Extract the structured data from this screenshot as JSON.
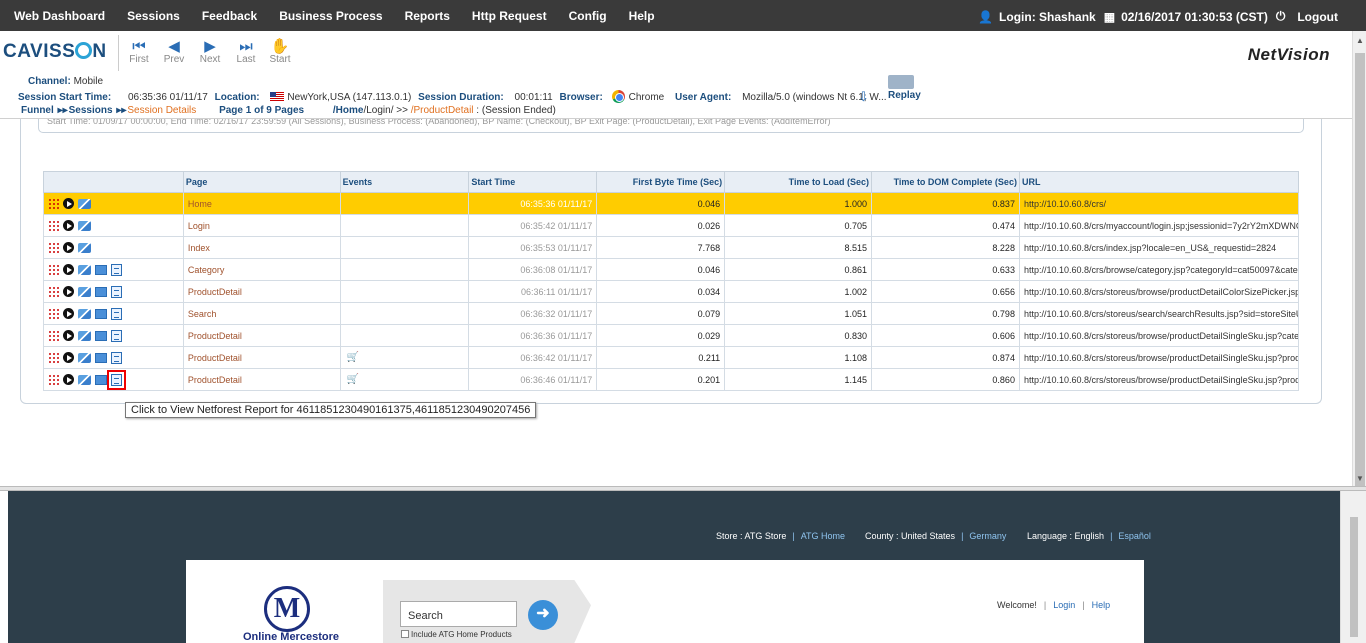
{
  "topnav": {
    "menu": [
      "Web Dashboard",
      "Sessions",
      "Feedback",
      "Business Process",
      "Reports",
      "Http Request",
      "Config",
      "Help"
    ],
    "login": "Login: Shashank",
    "datetime": "02/16/2017 01:30:53 (CST)",
    "logout": "Logout"
  },
  "header": {
    "logo": "CAVISS",
    "logo_tail": "N",
    "product": "NetVision",
    "nav": [
      {
        "label": "First",
        "glyph": "⏮"
      },
      {
        "label": "Prev",
        "glyph": "◀"
      },
      {
        "label": "Next",
        "glyph": "▶"
      },
      {
        "label": "Last",
        "glyph": "⏭"
      },
      {
        "label": "Start",
        "glyph": "✋"
      }
    ]
  },
  "session": {
    "channel_label": "Channel:",
    "channel": "Mobile",
    "start_label": "Session Start Time:",
    "start": "06:35:36 01/11/17",
    "location_label": "Location:",
    "location": "NewYork,USA (147.113.0.1)",
    "duration_label": "Session Duration:",
    "duration": "00:01:11",
    "browser_label": "Browser:",
    "browser": "Chrome",
    "agent_label": "User Agent:",
    "agent": "Mozilla/5.0 (windows Nt 6.1; W...",
    "replay": "Replay"
  },
  "breadcrumb": {
    "funnel": "Funnel",
    "sessions": "Sessions",
    "details": "Session Details",
    "page_of": "Page 1 of 9 Pages",
    "path_home": "/Home",
    "path_mid": "/Login/ >> ",
    "path_last": "/ProductDetail",
    "path_tail": " : (Session Ended)"
  },
  "filter_text": "Start Time: 01/09/17 00:00:00, End Time: 02/16/17 23:59:59 (All Sessions), Business Process: (Abandoned), BP Name: (Checkout), BP Exit Page: (ProductDetail), Exit Page Events: (AddItemError)",
  "table": {
    "headers": [
      "",
      "Page",
      "Events",
      "Start Time",
      "First Byte Time (Sec)",
      "Time to Load (Sec)",
      "Time to DOM Complete (Sec)",
      "URL"
    ],
    "rows": [
      {
        "page": "Home",
        "events": "",
        "start": "06:35:36 01/11/17",
        "fbt": "0.046",
        "ttl": "1.000",
        "dom": "0.837",
        "url": "http://10.10.60.8/crs/",
        "extra_icons": false,
        "cart": false
      },
      {
        "page": "Login",
        "events": "",
        "start": "06:35:42 01/11/17",
        "fbt": "0.026",
        "ttl": "0.705",
        "dom": "0.474",
        "url": "http://10.10.60.8/crs/myaccount/login.jsp;jsessionid=7y2rY2mXDWNG...",
        "extra_icons": false,
        "cart": false
      },
      {
        "page": "Index",
        "events": "",
        "start": "06:35:53 01/11/17",
        "fbt": "7.768",
        "ttl": "8.515",
        "dom": "8.228",
        "url": "http://10.10.60.8/crs/index.jsp?locale=en_US&_requestid=2824",
        "extra_icons": false,
        "cart": false
      },
      {
        "page": "Category",
        "events": "",
        "start": "06:36:08 01/11/17",
        "fbt": "0.046",
        "ttl": "0.861",
        "dom": "0.633",
        "url": "http://10.10.60.8/crs/browse/category.jsp?categoryId=cat50097&cate...",
        "extra_icons": true,
        "cart": false
      },
      {
        "page": "ProductDetail",
        "events": "",
        "start": "06:36:11 01/11/17",
        "fbt": "0.034",
        "ttl": "1.002",
        "dom": "0.656",
        "url": "http://10.10.60.8/crs/storeus/browse/productDetailColorSizePicker.jsp...",
        "extra_icons": true,
        "cart": false
      },
      {
        "page": "Search",
        "events": "",
        "start": "06:36:32 01/11/17",
        "fbt": "0.079",
        "ttl": "1.051",
        "dom": "0.798",
        "url": "http://10.10.60.8/crs/storeus/search/searchResults.jsp?sid=storeSiteU...",
        "extra_icons": true,
        "cart": false
      },
      {
        "page": "ProductDetail",
        "events": "",
        "start": "06:36:36 01/11/17",
        "fbt": "0.029",
        "ttl": "0.830",
        "dom": "0.606",
        "url": "http://10.10.60.8/crs/storeus/browse/productDetailSingleSku.jsp?cate...",
        "extra_icons": true,
        "cart": false
      },
      {
        "page": "ProductDetail",
        "events": "",
        "start": "06:36:42 01/11/17",
        "fbt": "0.211",
        "ttl": "1.108",
        "dom": "0.874",
        "url": "http://10.10.60.8/crs/storeus/browse/productDetailSingleSku.jsp?prod...",
        "extra_icons": true,
        "cart": true
      },
      {
        "page": "ProductDetail",
        "events": "",
        "start": "06:36:46 01/11/17",
        "fbt": "0.201",
        "ttl": "1.145",
        "dom": "0.860",
        "url": "http://10.10.60.8/crs/storeus/browse/productDetailSingleSku.jsp?prod...",
        "extra_icons": true,
        "cart": true
      }
    ]
  },
  "tooltip": "Click to View Netforest Report for 4611851230490161375,4611851230490207456",
  "store": {
    "store_label": "Store : ATG Store",
    "store_link": "ATG Home",
    "country_label": "County : United States",
    "country_link": "Germany",
    "lang_label": "Language : English",
    "lang_link": "Español",
    "search_placeholder": "Search",
    "include": "Include ATG Home Products",
    "welcome": "Welcome!",
    "login": "Login",
    "help": "Help",
    "logo_letter": "M",
    "logo_text": "Online Mercestore"
  },
  "colors": {
    "topnav_bg": "#3a3a3a",
    "selected_row": "#ffcc00",
    "brand": "#1c4e7e",
    "store_bg": "#2d3e4a"
  }
}
